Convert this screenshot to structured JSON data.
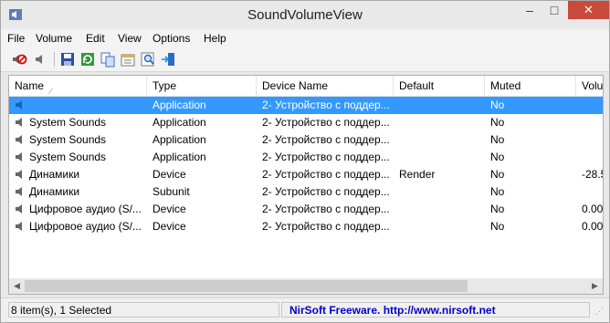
{
  "window": {
    "title": "SoundVolumeView",
    "min_glyph": "–",
    "max_glyph": "□",
    "close_glyph": "✕"
  },
  "menu": [
    "File",
    "Volume",
    "Edit",
    "View",
    "Options",
    "Help"
  ],
  "toolbar": [
    "mute-speaker-icon",
    "speaker-icon",
    "save-icon",
    "refresh-icon",
    "copy-icon",
    "properties-icon",
    "find-icon",
    "exit-icon"
  ],
  "columns": [
    "Name",
    "Type",
    "Device Name",
    "Default",
    "Muted",
    "Volu"
  ],
  "sort_glyph": "⁄",
  "rows": [
    {
      "name": "",
      "type": "Application",
      "device": "2- Устройство с поддер...",
      "default": "",
      "muted": "No",
      "volume": "",
      "selected": true
    },
    {
      "name": "System Sounds",
      "type": "Application",
      "device": "2- Устройство с поддер...",
      "default": "",
      "muted": "No",
      "volume": ""
    },
    {
      "name": "System Sounds",
      "type": "Application",
      "device": "2- Устройство с поддер...",
      "default": "",
      "muted": "No",
      "volume": ""
    },
    {
      "name": "System Sounds",
      "type": "Application",
      "device": "2- Устройство с поддер...",
      "default": "",
      "muted": "No",
      "volume": ""
    },
    {
      "name": "Динамики",
      "type": "Device",
      "device": "2- Устройство с поддер...",
      "default": "Render",
      "muted": "No",
      "volume": "-28.5"
    },
    {
      "name": "Динамики",
      "type": "Subunit",
      "device": "2- Устройство с поддер...",
      "default": "",
      "muted": "No",
      "volume": ""
    },
    {
      "name": "Цифровое аудио (S/...",
      "type": "Device",
      "device": "2- Устройство с поддер...",
      "default": "",
      "muted": "No",
      "volume": "0.00"
    },
    {
      "name": "Цифровое аудио (S/...",
      "type": "Device",
      "device": "2- Устройство с поддер...",
      "default": "",
      "muted": "No",
      "volume": "0.00"
    }
  ],
  "scroll": {
    "left_glyph": "◀",
    "right_glyph": "▶"
  },
  "status": {
    "left": "8 item(s), 1 Selected",
    "right": "NirSoft Freeware.  http://www.nirsoft.net",
    "grip_glyph": "⋰"
  },
  "colors": {
    "selection": "#3399ff",
    "link": "#0000cc",
    "close_button": "#c74a3b"
  }
}
